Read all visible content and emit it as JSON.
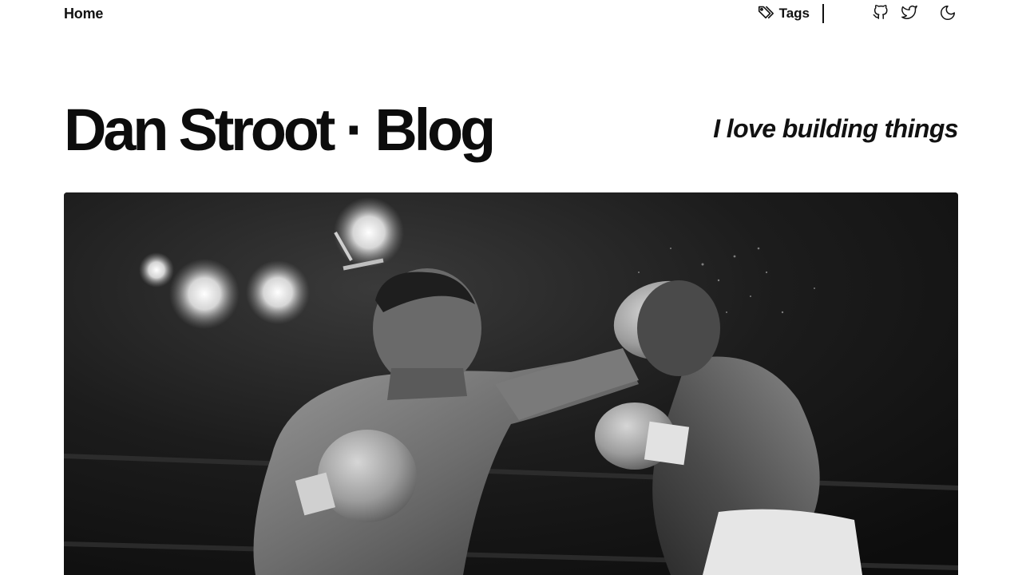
{
  "nav": {
    "home_label": "Home",
    "tags_label": "Tags",
    "icons": {
      "tags": "tag-icon",
      "github": "github-icon",
      "twitter": "twitter-icon",
      "theme": "moon-icon"
    }
  },
  "header": {
    "title": "Dan Stroot · Blog",
    "tagline": "I love building things"
  },
  "colors": {
    "text": "#111111",
    "background": "#ffffff"
  }
}
